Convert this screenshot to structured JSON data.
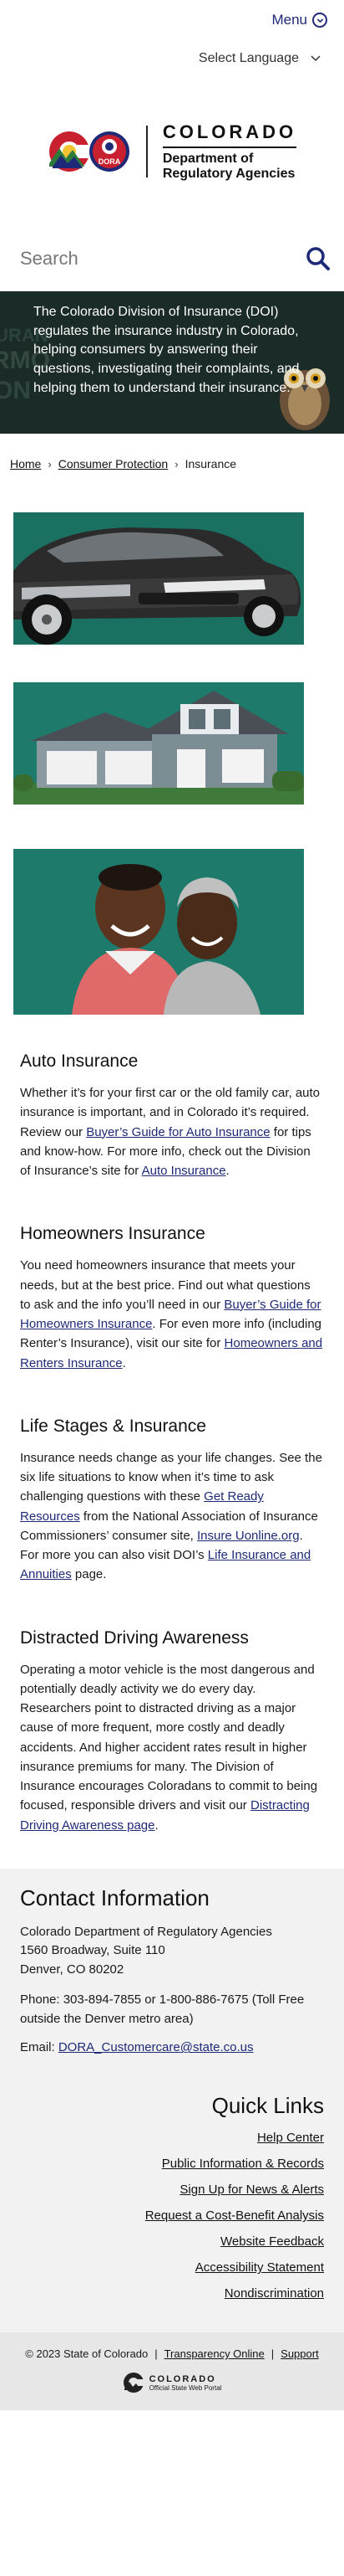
{
  "header": {
    "menu_label": "Menu",
    "language_label": "Select Language",
    "logo": {
      "state_name": "COLORADO",
      "dept_line1": "Department of",
      "dept_line2": "Regulatory Agencies",
      "seal_text": "DORA"
    }
  },
  "search": {
    "placeholder": "Search"
  },
  "hero": {
    "text": "The Colorado Division of Insurance (DOI) regulates the insurance industry in Colorado, helping consumers by answering their questions, investigating their complaints, and helping them to understand their insurance."
  },
  "breadcrumb": {
    "home": "Home",
    "consumer_protection": "Consumer Protection",
    "current": "Insurance"
  },
  "sections": {
    "auto": {
      "title": "Auto Insurance",
      "text1": "Whether it’s for your first car or the old family car, auto insurance is important, and in Colorado it’s required.  Review our ",
      "link1": "Buyer’s Guide for Auto Insurance",
      "text2": " for tips and know-how. For more info, check out the Division of Insurance’s site for ",
      "link2": "Auto Insurance",
      "text3": "."
    },
    "home": {
      "title": "Homeowners Insurance",
      "text1": "You need homeowners insurance that meets your needs, but at the best price.  Find out what questions to ask and the info you’ll need in our ",
      "link1": "Buyer’s Guide for Homeowners Insurance",
      "text2": ".  For even more info (including Renter’s Insurance), visit our site for ",
      "link2": "Homeowners and Renters Insurance",
      "text3": "."
    },
    "life": {
      "title": "Life Stages & Insurance",
      "text1": "Insurance needs change as your life changes.  See the six life situations to know when it’s time to ask challenging questions with these ",
      "link1": "Get Ready Resources",
      "text2": " from the National Association of Insurance Commissioners’ consumer site, ",
      "link2": "Insure Uonline.org",
      "text3": ". For more you can also visit DOI’s ",
      "link3": "Life Insurance and Annuities",
      "text4": " page."
    },
    "distracted": {
      "title": "Distracted Driving Awareness",
      "text1": "Operating a motor vehicle is the most dangerous and potentially deadly activity we do every day. Researchers point to distracted driving as a major cause of more frequent, more costly and deadly accidents. And higher accident rates result in higher insurance premiums for many. The Division of Insurance encourages Coloradans to commit to being focused, responsible drivers and visit our ",
      "link1": "Distracting Driving Awareness page",
      "text2": "."
    }
  },
  "contact": {
    "title": "Contact Information",
    "addr1": "Colorado Department of Regulatory Agencies",
    "addr2": "1560 Broadway, Suite 110",
    "addr3": "Denver, CO 80202",
    "phone": "Phone: 303-894-7855 or 1-800-886-7675 (Toll Free outside the Denver metro area)",
    "email_label": "Email: ",
    "email": "DORA_Customercare@state.co.us"
  },
  "quick_links": {
    "title": "Quick Links",
    "items": [
      "Help Center",
      "Public Information & Records",
      "Sign Up for News & Alerts",
      "Request a Cost-Benefit Analysis",
      "Website Feedback",
      "Accessibility Statement",
      "Nondiscrimination"
    ]
  },
  "footer": {
    "copyright": "© 2023 State of Colorado",
    "sep": "|",
    "transparency": "Transparency Online",
    "support": "Support",
    "portal_name": "COLORADO",
    "portal_sub": "Official State Web Portal"
  },
  "colors": {
    "brand_navy": "#1e2a78",
    "hero_bg": "#16231f",
    "tile_green": "#1e7a6a",
    "footer_bg": "#f2f2f2"
  },
  "icons": [
    "menu-circle-icon",
    "chevron-down-icon",
    "search-icon",
    "breadcrumb-chevron-icon"
  ]
}
